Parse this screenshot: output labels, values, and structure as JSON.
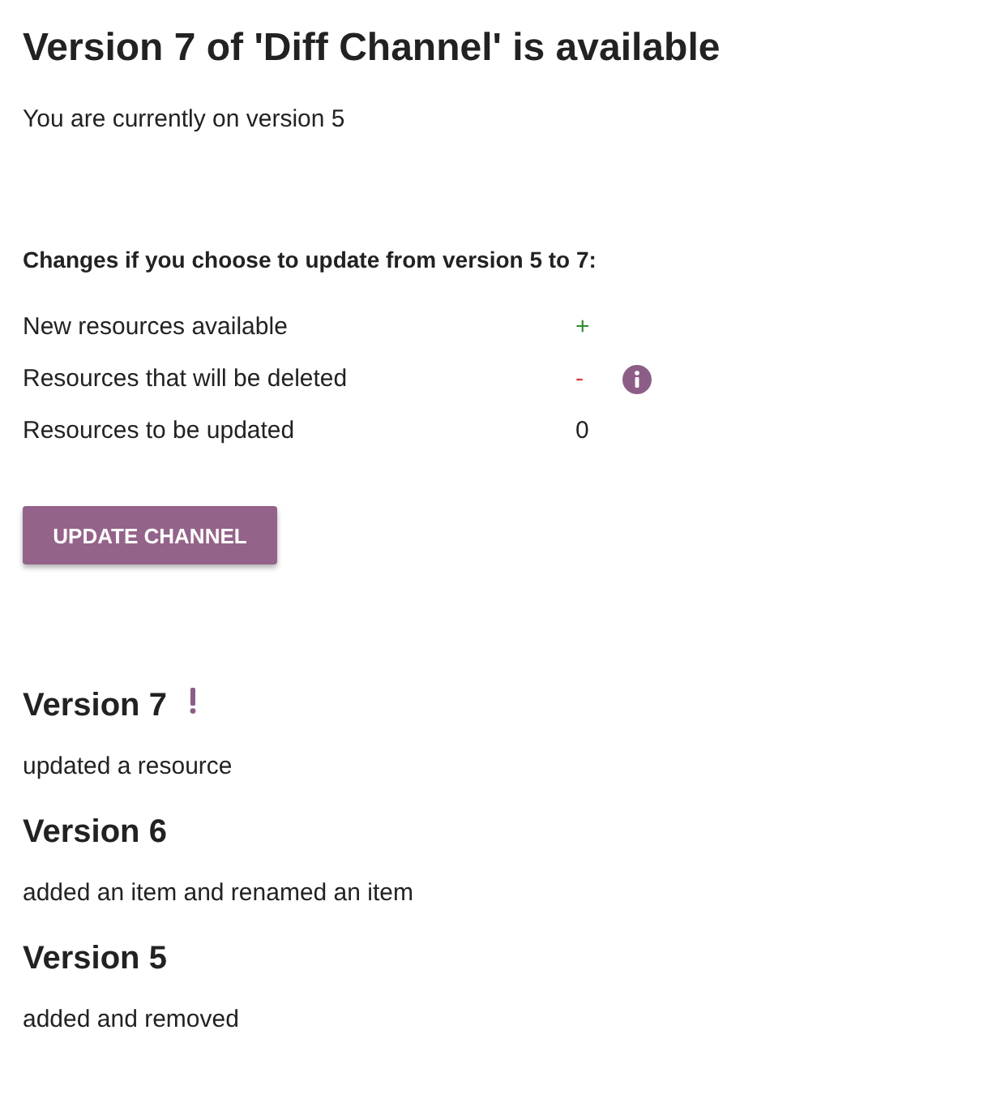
{
  "title": "Version 7 of 'Diff Channel' is available",
  "current_version": "You are currently on version 5",
  "changes": {
    "heading": "Changes if you choose to update from version 5 to 7:",
    "rows": [
      {
        "label": "New resources available",
        "value": "+",
        "kind": "added",
        "has_info": false
      },
      {
        "label": "Resources that will be deleted",
        "value": "-",
        "kind": "deleted",
        "has_info": true
      },
      {
        "label": "Resources to be updated",
        "value": "0",
        "kind": "updated",
        "has_info": false
      }
    ]
  },
  "button": "UPDATE CHANNEL",
  "versions": [
    {
      "name": "Version 7",
      "flagged": true,
      "description": "updated a resource"
    },
    {
      "name": "Version 6",
      "flagged": false,
      "description": "added an item and renamed an item"
    },
    {
      "name": "Version 5",
      "flagged": false,
      "description": "added and removed"
    }
  ]
}
